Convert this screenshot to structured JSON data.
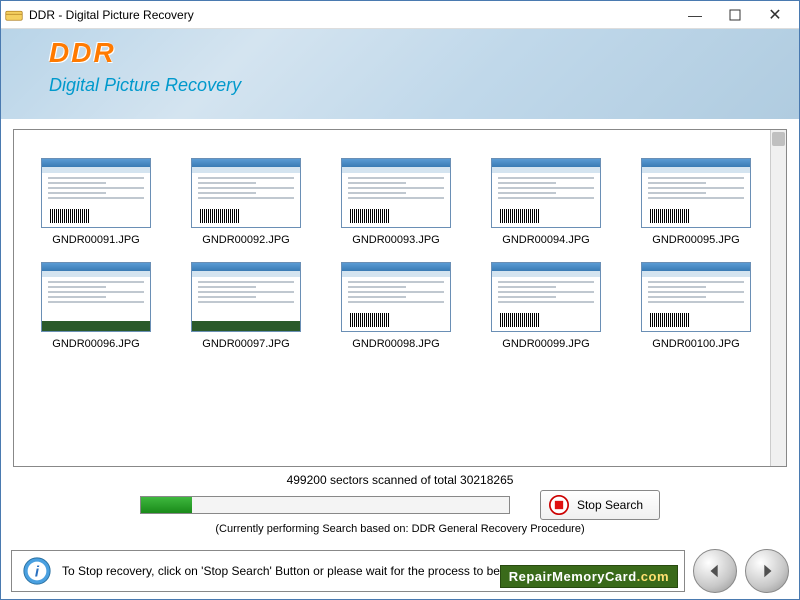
{
  "window": {
    "title": "DDR - Digital Picture Recovery"
  },
  "banner": {
    "logo": "DDR",
    "subtitle": "Digital Picture Recovery"
  },
  "results": {
    "items": [
      {
        "name": "GNDR00091.JPG"
      },
      {
        "name": "GNDR00092.JPG"
      },
      {
        "name": "GNDR00093.JPG"
      },
      {
        "name": "GNDR00094.JPG"
      },
      {
        "name": "GNDR00095.JPG"
      },
      {
        "name": "GNDR00096.JPG"
      },
      {
        "name": "GNDR00097.JPG"
      },
      {
        "name": "GNDR00098.JPG"
      },
      {
        "name": "GNDR00099.JPG"
      },
      {
        "name": "GNDR00100.JPG"
      }
    ]
  },
  "progress": {
    "status": "499200 sectors scanned of total 30218265",
    "note": "(Currently performing Search based on:  DDR General Recovery Procedure)",
    "stop_label": "Stop Search",
    "percent": 14
  },
  "footer": {
    "tip": "To Stop recovery, click on 'Stop Search' Button or please wait for the process to be completed.",
    "badge_a": "RepairMemoryCard",
    "badge_b": ".com"
  }
}
